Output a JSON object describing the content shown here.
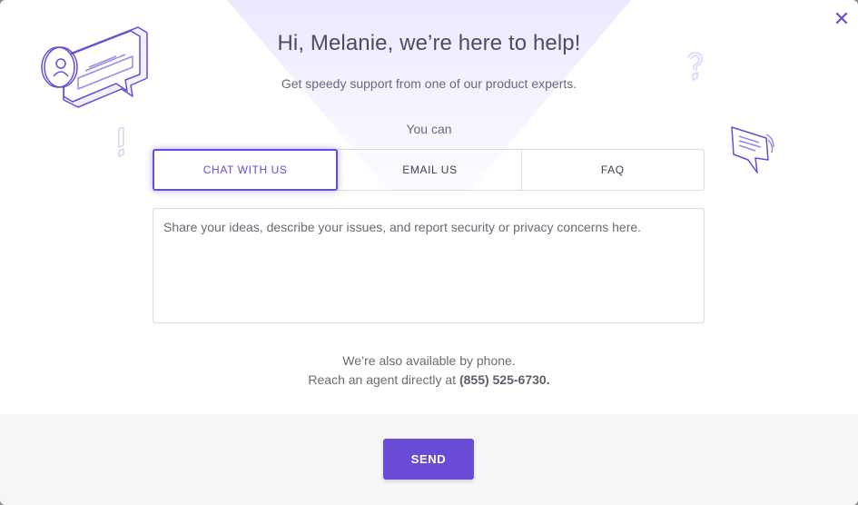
{
  "dialog": {
    "title": "Hi, Melanie, we’re here to help!",
    "subtitle": "Get speedy support from one of our product experts.",
    "options_label": "You can",
    "close_icon": "close-icon"
  },
  "tabs": [
    {
      "label": "CHAT WITH US",
      "active": true
    },
    {
      "label": "EMAIL US",
      "active": false
    },
    {
      "label": "FAQ",
      "active": false
    }
  ],
  "message": {
    "placeholder": "Share your ideas, describe your issues, and report security or privacy concerns here.",
    "value": ""
  },
  "phone": {
    "line1": "We’re also available by phone.",
    "line2_prefix": "Reach an agent directly at ",
    "number": "(855) 525-6730."
  },
  "footer": {
    "send_label": "SEND"
  },
  "colors": {
    "accent": "#6a4bd6",
    "text": "#4a4f5c",
    "footer_bg": "#f6f6f7"
  },
  "icons": [
    "chat-bubble-user-icon",
    "exclamation-icon",
    "question-mark-icon",
    "speech-bubble-icon"
  ]
}
